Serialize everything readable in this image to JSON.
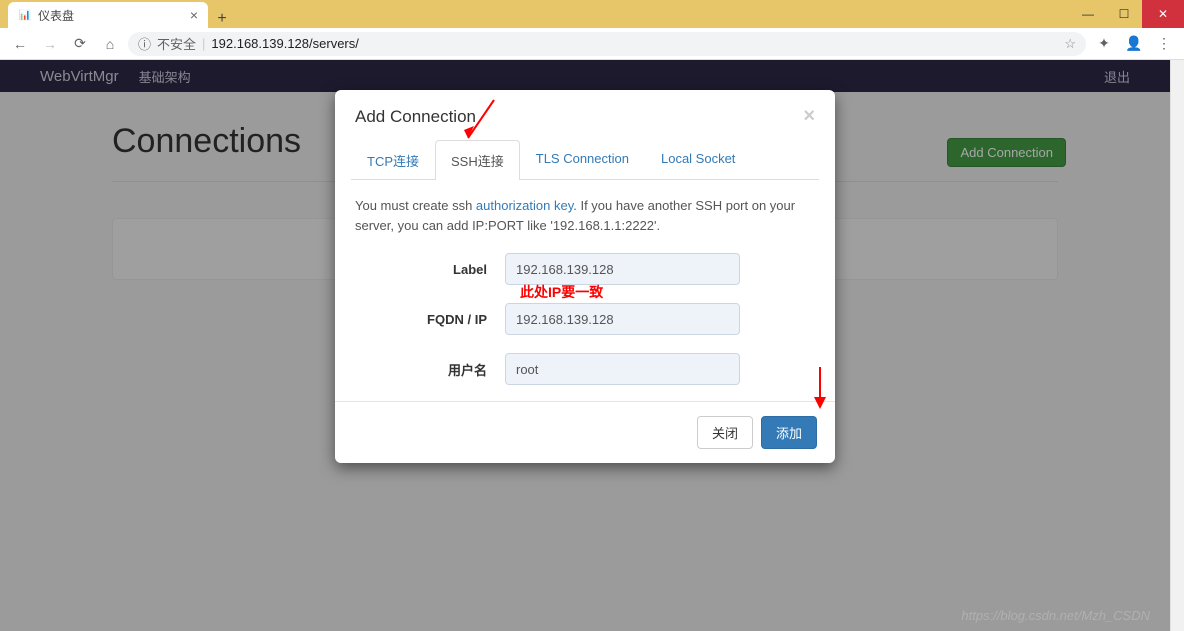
{
  "browser": {
    "tab_title": "仪表盘",
    "new_tab_glyph": "+",
    "tab_close_glyph": "×",
    "win_min": "—",
    "win_max": "☐",
    "win_close": "✕",
    "insecure_glyph": "ⓘ",
    "insecure_text": "不安全",
    "sep": "|",
    "url": "192.168.139.128/servers/",
    "star_glyph": "☆",
    "ext_glyph": "✦",
    "user_glyph": "👤",
    "menu_glyph": "⋮",
    "back_glyph": "←",
    "fwd_glyph": "→",
    "reload_glyph": "⟳",
    "home_glyph": "⌂"
  },
  "navbar": {
    "brand": "WebVirtMgr",
    "nav1": "基础架构",
    "logout": "退出"
  },
  "page": {
    "title": "Connections",
    "add_btn": "Add Connection"
  },
  "modal": {
    "title": "Add Connection",
    "close_glyph": "×",
    "tabs": {
      "tcp": "TCP连接",
      "ssh": "SSH连接",
      "tls": "TLS Connection",
      "local": "Local Socket"
    },
    "help_pre": "You must create ssh ",
    "help_link": "authorization key",
    "help_post": ". If you have another SSH port on your server, you can add IP:PORT like '192.168.1.1:2222'.",
    "labels": {
      "label": "Label",
      "fqdn": "FQDN / IP",
      "user": "用户名"
    },
    "values": {
      "label": "192.168.139.128",
      "fqdn": "192.168.139.128",
      "user": "root"
    },
    "footer": {
      "close": "关闭",
      "add": "添加"
    }
  },
  "annot": {
    "ip_note": "此处IP要一致"
  },
  "watermark": "https://blog.csdn.net/Mzh_CSDN"
}
